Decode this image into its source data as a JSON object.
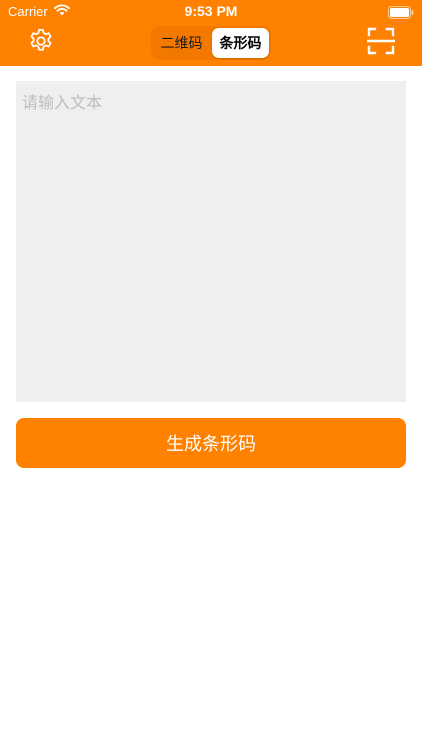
{
  "status_bar": {
    "carrier": "Carrier",
    "time": "9:53 PM"
  },
  "nav": {
    "settings_icon": "gear-icon",
    "scan_icon": "scan-frame-icon",
    "segments": [
      {
        "label": "二维码",
        "selected": false
      },
      {
        "label": "条形码",
        "selected": true
      }
    ]
  },
  "input": {
    "placeholder": "请输入文本",
    "value": ""
  },
  "generate_button": {
    "label": "生成条形码"
  },
  "colors": {
    "accent": "#FF8100",
    "input_bg": "#EFEFEF",
    "placeholder": "#BDBDBD"
  }
}
